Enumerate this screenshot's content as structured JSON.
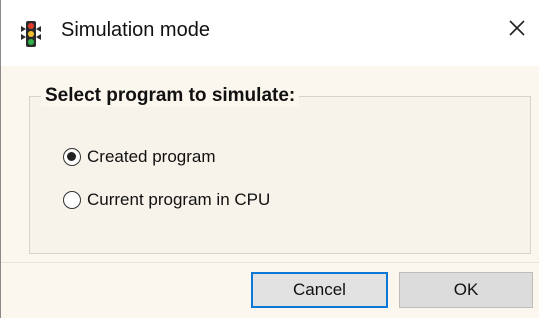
{
  "window": {
    "title": "Simulation mode",
    "icon": "traffic-light-icon",
    "close_icon": "close-icon"
  },
  "group": {
    "title": "Select program to simulate:"
  },
  "options": [
    {
      "label": "Created program",
      "checked": true
    },
    {
      "label": "Current program in CPU",
      "checked": false
    }
  ],
  "buttons": {
    "cancel": "Cancel",
    "ok": "OK"
  },
  "colors": {
    "dialog_bg": "#fbf7ee",
    "focus_border": "#0b78d6",
    "button_bg": "#e2e2e2"
  }
}
